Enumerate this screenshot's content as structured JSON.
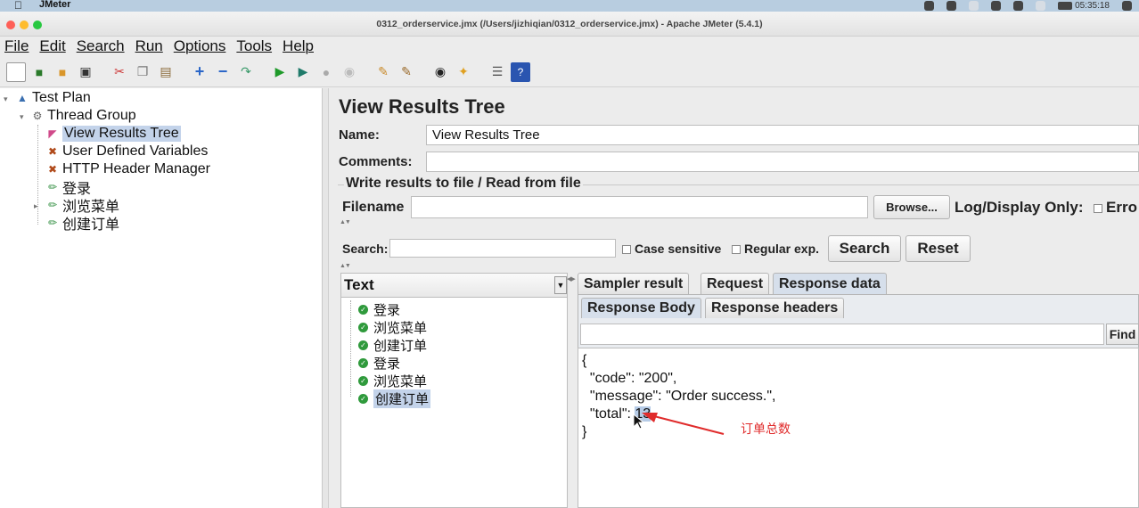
{
  "macbar": {
    "app_name": "JMeter",
    "clock": "05:35:18"
  },
  "window": {
    "title": "0312_orderservice.jmx (/Users/jizhiqian/0312_orderservice.jmx) - Apache JMeter (5.4.1)"
  },
  "menu": [
    "File",
    "Edit",
    "Search",
    "Run",
    "Options",
    "Tools",
    "Help"
  ],
  "toolbar_icons": [
    "new-icon",
    "templates-icon",
    "open-icon",
    "save-icon",
    "cut-icon",
    "copy-icon",
    "paste-icon",
    "expand-icon",
    "collapse-icon",
    "toggle-icon",
    "start-icon",
    "start-no-pause-icon",
    "stop-icon",
    "shutdown-icon",
    "clear-icon",
    "clear-all-icon",
    "search-icon",
    "reset-search-icon",
    "function-helper-icon",
    "help-icon"
  ],
  "tree": {
    "test_plan": "Test Plan",
    "thread_group": "Thread Group",
    "view_results_tree": "View Results Tree",
    "user_defined_variables": "User Defined Variables",
    "http_header_manager": "HTTP Header Manager",
    "login": "登录",
    "browse_menu": "浏览菜单",
    "create_order": "创建订单"
  },
  "panel": {
    "title": "View Results Tree",
    "name_label": "Name:",
    "name_value": "View Results Tree",
    "comments_label": "Comments:",
    "comments_value": "",
    "write_results_title": "Write results to file / Read from file",
    "filename_label": "Filename",
    "filename_value": "",
    "browse_button": "Browse...",
    "log_display_label": "Log/Display Only:",
    "errors_label": "Erro",
    "search_label": "Search:",
    "search_value": "",
    "case_sensitive_label": "Case sensitive",
    "regular_exp_label": "Regular exp.",
    "search_button": "Search",
    "reset_button": "Reset"
  },
  "results": {
    "renderer": "Text",
    "items": [
      "登录",
      "浏览菜单",
      "创建订单",
      "登录",
      "浏览菜单",
      "创建订单"
    ],
    "tabs": [
      "Sampler result",
      "Request",
      "Response data"
    ],
    "subtabs": [
      "Response Body",
      "Response headers"
    ],
    "find_button": "Find",
    "find_value": "",
    "body_lines": {
      "l1": "{",
      "l2": "  \"code\": \"200\",",
      "l3": "  \"message\": \"Order success.\",",
      "l4a": "  \"total\": ",
      "l4b": "13",
      "l5": "}"
    },
    "annotation": "订单总数",
    "annotation_color": "#e02b2b"
  }
}
